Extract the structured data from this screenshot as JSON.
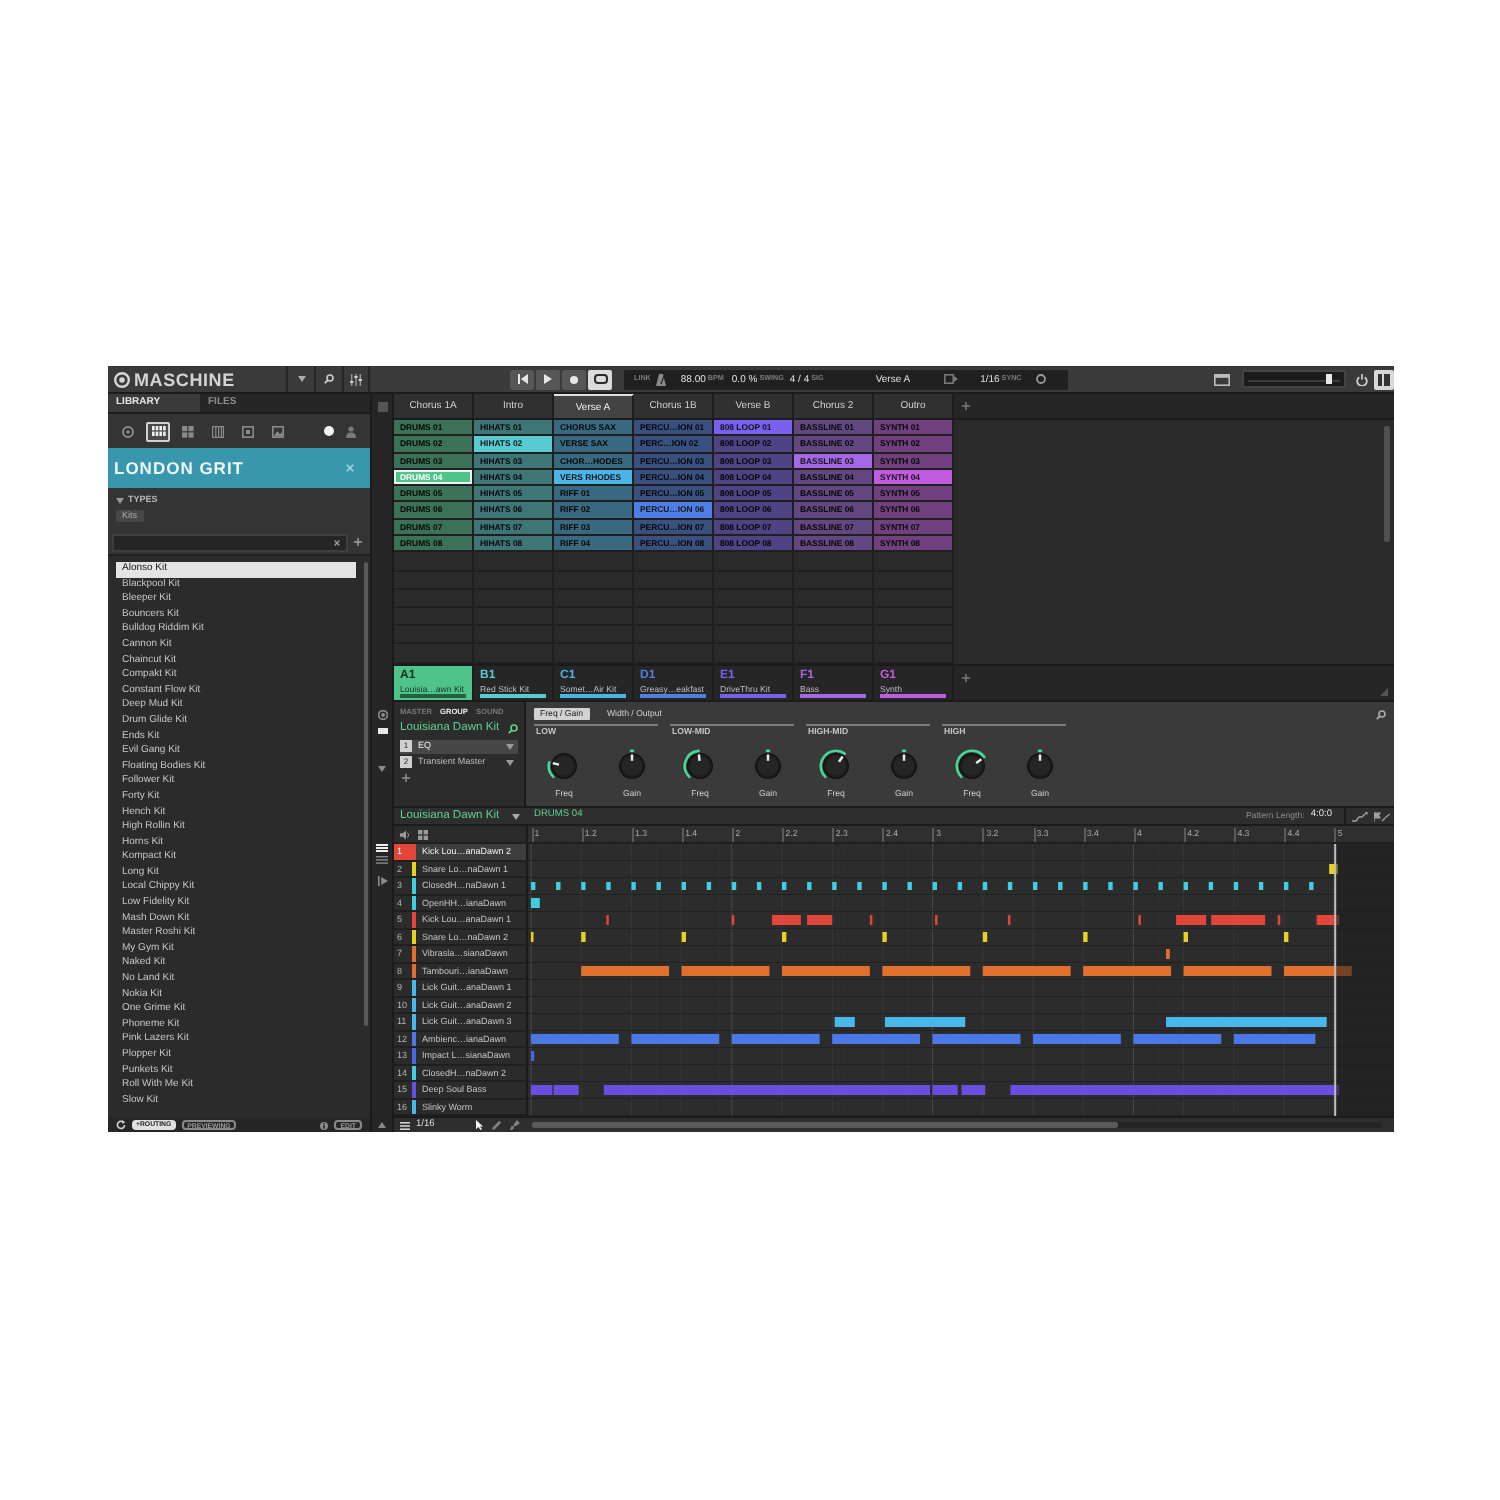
{
  "header": {
    "logo": "MASCHINE",
    "transport": [
      {
        "kind": "restart",
        "on": false
      },
      {
        "kind": "play",
        "on": false
      },
      {
        "kind": "record",
        "on": false
      },
      {
        "kind": "loop",
        "on": true
      }
    ],
    "display": {
      "link": "LINK",
      "tempo": "88.00",
      "tempo_unit": "BPM",
      "swing": "0.0 %",
      "swing_unit": "SWING",
      "signature": "4 / 4",
      "signature_unit": "SIG",
      "scene": "Verse A",
      "grid": "1/16",
      "grid_unit": "SYNC"
    },
    "master_volume": {
      "level": 0.88
    }
  },
  "browser": {
    "tabs": [
      {
        "label": "LIBRARY",
        "selected": true
      },
      {
        "label": "FILES",
        "selected": false
      }
    ],
    "filters": [
      {
        "kind": "project",
        "selected": false
      },
      {
        "kind": "group",
        "selected": true
      },
      {
        "kind": "sound",
        "selected": false
      },
      {
        "kind": "instrument",
        "selected": false
      },
      {
        "kind": "effect",
        "selected": false
      },
      {
        "kind": "loop",
        "selected": false
      }
    ],
    "sources": [
      {
        "kind": "factory",
        "selected": true
      },
      {
        "kind": "user",
        "selected": false
      }
    ],
    "bank": "LONDON GRIT",
    "types": {
      "label": "TYPES",
      "expanded": true,
      "tags": [
        "Kits"
      ]
    },
    "results": [
      {
        "label": "Alonso Kit",
        "selected": true
      },
      {
        "label": "Blackpool Kit",
        "selected": false
      },
      {
        "label": "Bleeper Kit",
        "selected": false
      },
      {
        "label": "Bouncers Kit",
        "selected": false
      },
      {
        "label": "Bulldog Riddim Kit",
        "selected": false
      },
      {
        "label": "Cannon Kit",
        "selected": false
      },
      {
        "label": "Chaincut Kit",
        "selected": false
      },
      {
        "label": "Compakt Kit",
        "selected": false
      },
      {
        "label": "Constant Flow Kit",
        "selected": false
      },
      {
        "label": "Deep Mud Kit",
        "selected": false
      },
      {
        "label": "Drum Glide Kit",
        "selected": false
      },
      {
        "label": "Ends Kit",
        "selected": false
      },
      {
        "label": "Evil Gang Kit",
        "selected": false
      },
      {
        "label": "Floating Bodies Kit",
        "selected": false
      },
      {
        "label": "Follower Kit",
        "selected": false
      },
      {
        "label": "Forty Kit",
        "selected": false
      },
      {
        "label": "Hench Kit",
        "selected": false
      },
      {
        "label": "High Rollin Kit",
        "selected": false
      },
      {
        "label": "Horns Kit",
        "selected": false
      },
      {
        "label": "Kompact Kit",
        "selected": false
      },
      {
        "label": "Long Kit",
        "selected": false
      },
      {
        "label": "Local Chippy Kit",
        "selected": false
      },
      {
        "label": "Low Fidelity Kit",
        "selected": false
      },
      {
        "label": "Mash Down Kit",
        "selected": false
      },
      {
        "label": "Master Roshi Kit",
        "selected": false
      },
      {
        "label": "My Gym Kit",
        "selected": false
      },
      {
        "label": "Naked Kit",
        "selected": false
      },
      {
        "label": "No Land Kit",
        "selected": false
      },
      {
        "label": "Nokia Kit",
        "selected": false
      },
      {
        "label": "One Grime Kit",
        "selected": false
      },
      {
        "label": "Phoneme Kit",
        "selected": false
      },
      {
        "label": "Pink Lazers Kit",
        "selected": false
      },
      {
        "label": "Plopper Kit",
        "selected": false
      },
      {
        "label": "Punkets Kit",
        "selected": false
      },
      {
        "label": "Roll With Me Kit",
        "selected": false
      },
      {
        "label": "Slow Kit",
        "selected": false
      }
    ],
    "footer": {
      "buttons": [
        {
          "label": "+ROUTING",
          "on": true
        },
        {
          "label": "PREVIEWING",
          "on": false
        },
        {
          "label": "EDIT",
          "on": false
        }
      ]
    }
  },
  "ideas": {
    "scenes": [
      {
        "label": "Chorus 1A",
        "selected": false
      },
      {
        "label": "Intro",
        "selected": false
      },
      {
        "label": "Verse A",
        "selected": true
      },
      {
        "label": "Chorus 1B",
        "selected": false
      },
      {
        "label": "Verse B",
        "selected": false
      },
      {
        "label": "Chorus 2",
        "selected": false
      },
      {
        "label": "Outro",
        "selected": false
      }
    ],
    "columns": [
      {
        "clips": [
          {
            "label": "DRUMS 01",
            "selected": false,
            "focused": false
          },
          {
            "label": "DRUMS 02",
            "selected": false,
            "focused": false
          },
          {
            "label": "DRUMS 03",
            "selected": false,
            "focused": false
          },
          {
            "label": "DRUMS 04",
            "selected": true,
            "focused": true
          },
          {
            "label": "DRUMS 05",
            "selected": false,
            "focused": false
          },
          {
            "label": "DRUMS 06",
            "selected": false,
            "focused": false
          },
          {
            "label": "DRUMS 07",
            "selected": false,
            "focused": false
          },
          {
            "label": "DRUMS 08",
            "selected": false,
            "focused": false
          }
        ]
      },
      {
        "clips": [
          {
            "label": "HIHATS 01",
            "selected": false,
            "focused": false
          },
          {
            "label": "HIHATS 02",
            "selected": true,
            "focused": false
          },
          {
            "label": "HIHATS 03",
            "selected": false,
            "focused": false
          },
          {
            "label": "HIHATS 04",
            "selected": false,
            "focused": false
          },
          {
            "label": "HIHATS 05",
            "selected": false,
            "focused": false
          },
          {
            "label": "HIHATS 06",
            "selected": false,
            "focused": false
          },
          {
            "label": "HIHATS 07",
            "selected": false,
            "focused": false
          },
          {
            "label": "HIHATS 08",
            "selected": false,
            "focused": false
          }
        ]
      },
      {
        "clips": [
          {
            "label": "CHORUS SAX",
            "selected": false,
            "focused": false
          },
          {
            "label": "VERSE SAX",
            "selected": false,
            "focused": false
          },
          {
            "label": "CHOR…HODES",
            "selected": false,
            "focused": false
          },
          {
            "label": "VERS RHODES",
            "selected": true,
            "focused": false
          },
          {
            "label": "RIFF 01",
            "selected": false,
            "focused": false
          },
          {
            "label": "RIFF 02",
            "selected": false,
            "focused": false
          },
          {
            "label": "RIFF 03",
            "selected": false,
            "focused": false
          },
          {
            "label": "RIFF 04",
            "selected": false,
            "focused": false
          }
        ]
      },
      {
        "clips": [
          {
            "label": "PERCU…ION 01",
            "selected": false,
            "focused": false
          },
          {
            "label": "PERC…ION 02",
            "selected": false,
            "focused": false
          },
          {
            "label": "PERCU…ION 03",
            "selected": false,
            "focused": false
          },
          {
            "label": "PERCU…ION 04",
            "selected": false,
            "focused": false
          },
          {
            "label": "PERCU…ION 05",
            "selected": false,
            "focused": false
          },
          {
            "label": "PERCU…ION 06",
            "selected": true,
            "focused": false
          },
          {
            "label": "PERCU…ION 07",
            "selected": false,
            "focused": false
          },
          {
            "label": "PERCU…ION 08",
            "selected": false,
            "focused": false
          }
        ]
      },
      {
        "clips": [
          {
            "label": "808 LOOP 01",
            "selected": true,
            "focused": false
          },
          {
            "label": "808 LOOP 02",
            "selected": false,
            "focused": false
          },
          {
            "label": "808 LOOP 03",
            "selected": false,
            "focused": false
          },
          {
            "label": "808 LOOP 04",
            "selected": false,
            "focused": false
          },
          {
            "label": "808 LOOP 05",
            "selected": false,
            "focused": false
          },
          {
            "label": "808 LOOP 06",
            "selected": false,
            "focused": false
          },
          {
            "label": "808 LOOP 07",
            "selected": false,
            "focused": false
          },
          {
            "label": "808 LOOP 08",
            "selected": false,
            "focused": false
          }
        ]
      },
      {
        "clips": [
          {
            "label": "BASSLINE 01",
            "selected": false,
            "focused": false
          },
          {
            "label": "BASSLINE 02",
            "selected": false,
            "focused": false
          },
          {
            "label": "BASSLINE 03",
            "selected": true,
            "focused": false
          },
          {
            "label": "BASSLINE 04",
            "selected": false,
            "focused": false
          },
          {
            "label": "BASSLINE 05",
            "selected": false,
            "focused": false
          },
          {
            "label": "BASSLINE 06",
            "selected": false,
            "focused": false
          },
          {
            "label": "BASSLINE 07",
            "selected": false,
            "focused": false
          },
          {
            "label": "BASSLINE 08",
            "selected": false,
            "focused": false
          }
        ]
      },
      {
        "clips": [
          {
            "label": "SYNTH 01",
            "selected": false,
            "focused": false
          },
          {
            "label": "SYNTH 02",
            "selected": false,
            "focused": false
          },
          {
            "label": "SYNTH 03",
            "selected": false,
            "focused": false
          },
          {
            "label": "SYNTH 04",
            "selected": true,
            "focused": false
          },
          {
            "label": "SYNTH 05",
            "selected": false,
            "focused": false
          },
          {
            "label": "SYNTH 06",
            "selected": false,
            "focused": false
          },
          {
            "label": "SYNTH 07",
            "selected": false,
            "focused": false
          },
          {
            "label": "SYNTH 08",
            "selected": false,
            "focused": false
          }
        ]
      }
    ],
    "groups": [
      {
        "slot": "A1",
        "name": "Louisia…awn Kit",
        "color": "#4fc489",
        "selected": true
      },
      {
        "slot": "B1",
        "name": "Red Stick Kit",
        "color": "#56ccd2",
        "selected": false
      },
      {
        "slot": "C1",
        "name": "Somet…Air Kit",
        "color": "#4bb4e6",
        "selected": false
      },
      {
        "slot": "D1",
        "name": "Greasy…eakfast",
        "color": "#4d7fe6",
        "selected": false
      },
      {
        "slot": "E1",
        "name": "DriveThru Kit",
        "color": "#7a60ee",
        "selected": false
      },
      {
        "slot": "F1",
        "name": "Bass",
        "color": "#a468e6",
        "selected": false
      },
      {
        "slot": "G1",
        "name": "Synth",
        "color": "#c25be0",
        "selected": false
      }
    ]
  },
  "plugin": {
    "tabs": [
      {
        "label": "MASTER",
        "selected": false
      },
      {
        "label": "GROUP",
        "selected": true
      },
      {
        "label": "SOUND",
        "selected": false
      }
    ],
    "title": "Louisiana Dawn Kit",
    "slots": [
      {
        "number": "1",
        "name": "EQ",
        "selected": true
      },
      {
        "number": "2",
        "name": "Transient Master",
        "selected": false
      }
    ],
    "pages": [
      {
        "label": "Freq / Gain",
        "selected": true
      },
      {
        "label": "Width / Output",
        "selected": false
      }
    ],
    "bands": [
      {
        "label": "LOW",
        "knobs": [
          {
            "label": "Freq",
            "kind": "unipolar",
            "level": 0.22
          },
          {
            "label": "Gain",
            "kind": "bipolar",
            "level": 0.5
          }
        ]
      },
      {
        "label": "LOW-MID",
        "knobs": [
          {
            "label": "Freq",
            "kind": "unipolar",
            "level": 0.48
          },
          {
            "label": "Gain",
            "kind": "bipolar",
            "level": 0.5
          }
        ]
      },
      {
        "label": "HIGH-MID",
        "knobs": [
          {
            "label": "Freq",
            "kind": "unipolar",
            "level": 0.63
          },
          {
            "label": "Gain",
            "kind": "bipolar",
            "level": 0.5
          }
        ]
      },
      {
        "label": "HIGH",
        "knobs": [
          {
            "label": "Freq",
            "kind": "unipolar",
            "level": 0.7
          },
          {
            "label": "Gain",
            "kind": "bipolar",
            "level": 0.5
          }
        ]
      }
    ]
  },
  "pattern_editor": {
    "group": "Louisiana Dawn Kit",
    "pattern": "DRUMS 04",
    "length_label": "Pattern Length:",
    "length": "4:0:0",
    "ruler": [
      "1",
      "1.2",
      "1.3",
      "1.4",
      "2",
      "2.2",
      "2.3",
      "2.4",
      "3",
      "3.2",
      "3.3",
      "3.4",
      "4",
      "4.2",
      "4.3",
      "4.4",
      "5"
    ],
    "sounds": [
      {
        "number": "1",
        "name": "Kick Lou…anaDawn 2",
        "color": "#e2463a",
        "selected": true
      },
      {
        "number": "2",
        "name": "Snare Lo…naDawn 1",
        "color": "#e8d21e",
        "selected": false
      },
      {
        "number": "3",
        "name": "ClosedH…naDawn 1",
        "color": "#3fcfe0",
        "selected": false
      },
      {
        "number": "4",
        "name": "OpenHH…ianaDawn",
        "color": "#3fcfe0",
        "selected": false
      },
      {
        "number": "5",
        "name": "Kick Lou…anaDawn 1",
        "color": "#e2463a",
        "selected": false
      },
      {
        "number": "6",
        "name": "Snare Lo…naDawn 2",
        "color": "#e8d21e",
        "selected": false
      },
      {
        "number": "7",
        "name": "Vibrasla…sianaDawn",
        "color": "#e0702c",
        "selected": false
      },
      {
        "number": "8",
        "name": "Tambouri…ianaDawn",
        "color": "#e0702c",
        "selected": false
      },
      {
        "number": "9",
        "name": "Lick Guit…anaDawn 1",
        "color": "#48b8ea",
        "selected": false
      },
      {
        "number": "10",
        "name": "Lick Guit…anaDawn 2",
        "color": "#48b8ea",
        "selected": false
      },
      {
        "number": "11",
        "name": "Lick Guit…anaDawn 3",
        "color": "#48b8ea",
        "selected": false
      },
      {
        "number": "12",
        "name": "Ambienc…ianaDawn",
        "color": "#4a78e4",
        "selected": false
      },
      {
        "number": "13",
        "name": "Impact L…sianaDawn",
        "color": "#4a66dc",
        "selected": false
      },
      {
        "number": "14",
        "name": "ClosedH…naDawn 2",
        "color": "#3fcfe0",
        "selected": false
      },
      {
        "number": "15",
        "name": "Deep Soul Bass",
        "color": "#6a4ee0",
        "selected": false
      },
      {
        "number": "16",
        "name": "Slinky Worm",
        "color": "#48b8ea",
        "selected": false
      }
    ],
    "tools": [
      {
        "kind": "select",
        "selected": true
      },
      {
        "kind": "draw",
        "selected": false
      },
      {
        "kind": "erase",
        "selected": false
      }
    ],
    "footer": {
      "grid": "1/16"
    }
  }
}
